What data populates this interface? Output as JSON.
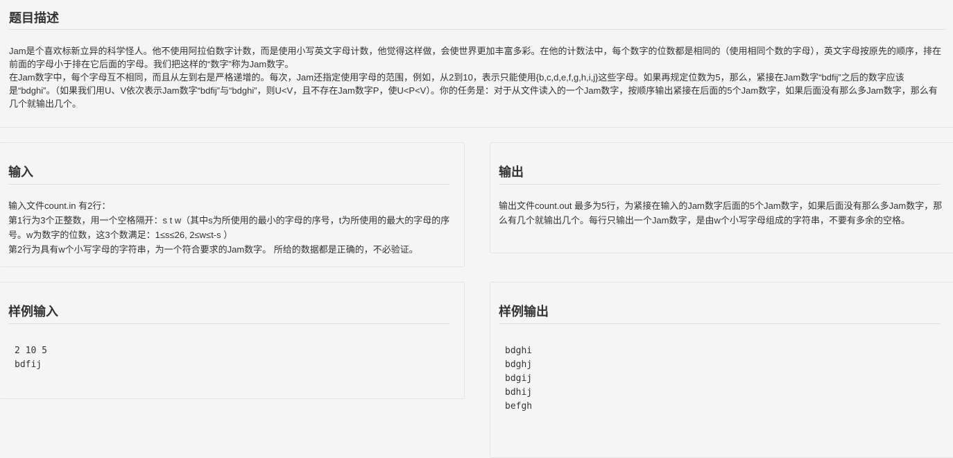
{
  "description": {
    "title": "题目描述",
    "paragraphs": [
      "Jam是个喜欢标新立异的科学怪人。他不使用阿拉伯数字计数，而是使用小写英文字母计数，他觉得这样做，会使世界更加丰富多彩。在他的计数法中，每个数字的位数都是相同的（使用相同个数的字母），英文字母按原先的顺序，排在前面的字母小于排在它后面的字母。我们把这样的“数字”称为Jam数字。",
      "在Jam数字中，每个字母互不相同，而且从左到右是严格递增的。每次，Jam还指定使用字母的范围，例如，从2到10，表示只能使用{b,c,d,e,f,g,h,i,j}这些字母。如果再规定位数为5，那么，紧接在Jam数字“bdfij”之后的数字应该是“bdghi”。（如果我们用U、V依次表示Jam数字“bdfij”与“bdghi”，则U<V，且不存在Jam数字P，使U<P<V）。你的任务是：对于从文件读入的一个Jam数字，按顺序输出紧接在后面的5个Jam数字，如果后面没有那么多Jam数字，那么有几个就输出几个。"
    ]
  },
  "input": {
    "title": "输入",
    "lines": [
      "输入文件count.in 有2行：",
      "第1行为3个正整数，用一个空格隔开：s t w（其中s为所使用的最小的字母的序号，t为所使用的最大的字母的序号。w为数字的位数，这3个数满足：1≤s≤26, 2≤w≤t-s ）",
      "第2行为具有w个小写字母的字符串，为一个符合要求的Jam数字。 所给的数据都是正确的，不必验证。"
    ]
  },
  "output": {
    "title": "输出",
    "text": "输出文件count.out 最多为5行，为紧接在输入的Jam数字后面的5个Jam数字，如果后面没有那么多Jam数字，那么有几个就输出几个。每行只输出一个Jam数字，是由w个小写字母组成的字符串，不要有多余的空格。"
  },
  "sample_input": {
    "title": "样例输入",
    "text": "2 10 5\nbdfij"
  },
  "sample_output": {
    "title": "样例输出",
    "text": "bdghi\nbdghj\nbdgij\nbdhij\nbefgh"
  }
}
